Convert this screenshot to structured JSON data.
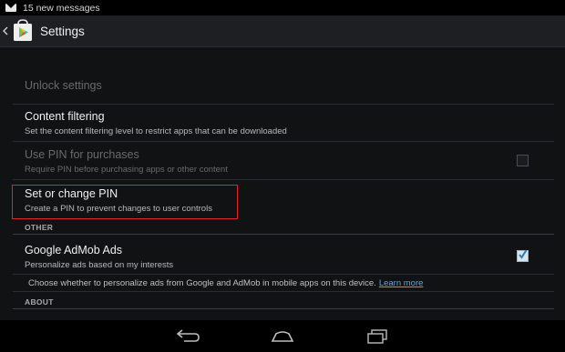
{
  "status_bar": {
    "notification_text": "15 new messages",
    "icon": "mail-icon"
  },
  "action_bar": {
    "title": "Settings",
    "icons": [
      "back-icon",
      "play-store-icon"
    ]
  },
  "settings": {
    "unlock": {
      "title": "Unlock settings"
    },
    "content_filtering": {
      "title": "Content filtering",
      "subtitle": "Set the content filtering level to restrict apps that can be downloaded"
    },
    "use_pin": {
      "title": "Use PIN for purchases",
      "subtitle": "Require PIN before purchasing apps or other content",
      "checked": false
    },
    "change_pin": {
      "title": "Set or change PIN",
      "subtitle": "Create a PIN to prevent changes to user controls"
    },
    "other_header": "OTHER",
    "admob": {
      "title": "Google AdMob Ads",
      "subtitle": "Personalize ads based on my interests",
      "checked": true
    },
    "info": {
      "text": "Choose whether to personalize ads from Google and AdMob in mobile apps on this device.",
      "link": "Learn more"
    },
    "about_header": "ABOUT"
  },
  "nav_bar": {
    "buttons": [
      "back-nav-icon",
      "home-nav-icon",
      "recents-nav-icon"
    ]
  },
  "colors": {
    "accent": "#5aa6dc",
    "highlight": "#d62a2a"
  }
}
